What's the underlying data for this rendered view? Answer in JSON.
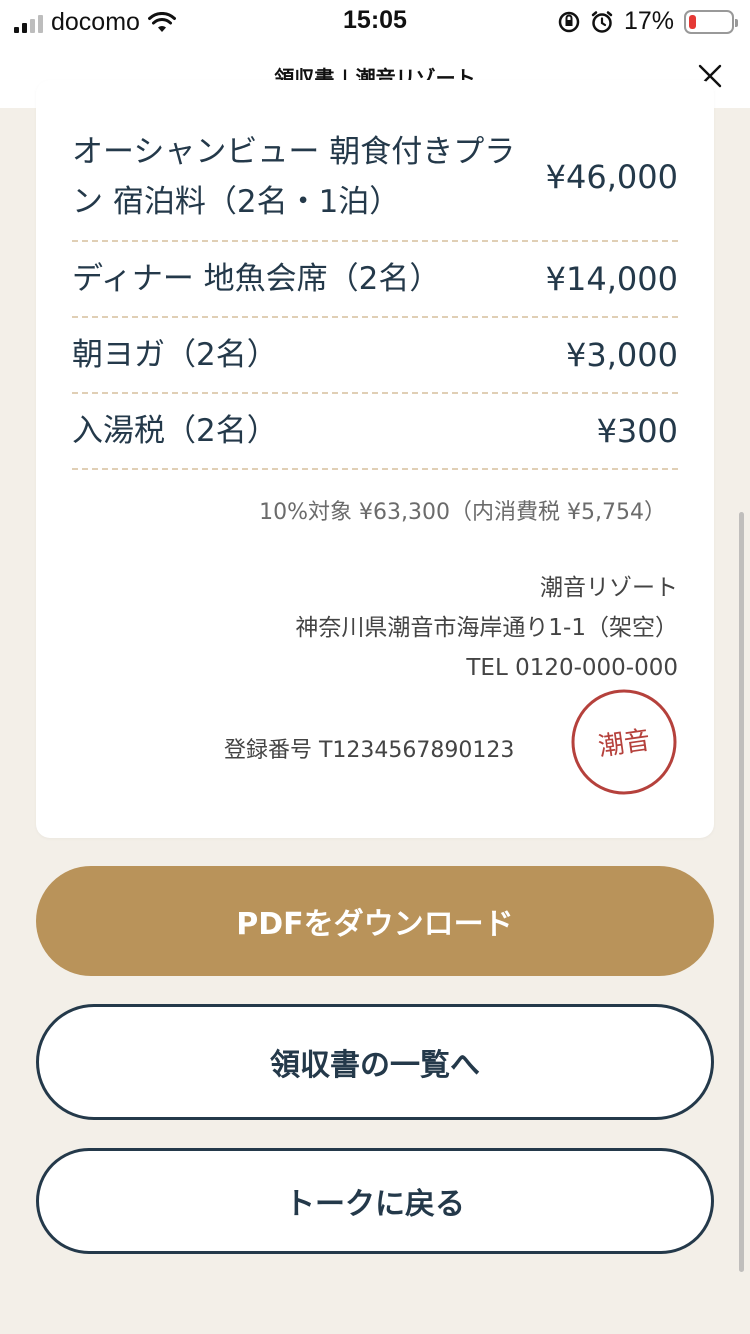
{
  "status_bar": {
    "carrier": "docomo",
    "time": "15:05",
    "battery": "17%",
    "battery_level": 0.17,
    "icons": [
      "signal-icon",
      "wifi-icon",
      "orientation-lock-icon",
      "alarm-icon",
      "battery-icon"
    ]
  },
  "header": {
    "title": "領収書 | 潮音リゾート",
    "close_icon": "close-icon"
  },
  "receipt": {
    "items": [
      {
        "name": "オーシャンビュー 朝食付きプラン 宿泊料（2名・1泊）",
        "price": "¥46,000"
      },
      {
        "name": "ディナー 地魚会席（2名）",
        "price": "¥14,000"
      },
      {
        "name": "朝ヨガ（2名）",
        "price": "¥3,000"
      },
      {
        "name": "入湯税（2名）",
        "price": "¥300"
      }
    ],
    "tax_line": "10%対象 ¥63,300（内消費税 ¥5,754）",
    "issuer": {
      "name": "潮音リゾート",
      "address": "神奈川県潮音市海岸通り1-1（架空）",
      "tel": "TEL 0120-000-000"
    },
    "registration": "登録番号 T1234567890123",
    "seal_text": "潮音"
  },
  "buttons": {
    "download_pdf": "PDFをダウンロード",
    "receipt_list": "領収書の一覧へ",
    "back_to_talk": "トークに戻る"
  },
  "colors": {
    "background": "#f3efe8",
    "text_navy": "#24394a",
    "primary_gold": "#b9935a",
    "dashed_divider": "#e0cfb5",
    "seal_red": "#b5413c"
  }
}
